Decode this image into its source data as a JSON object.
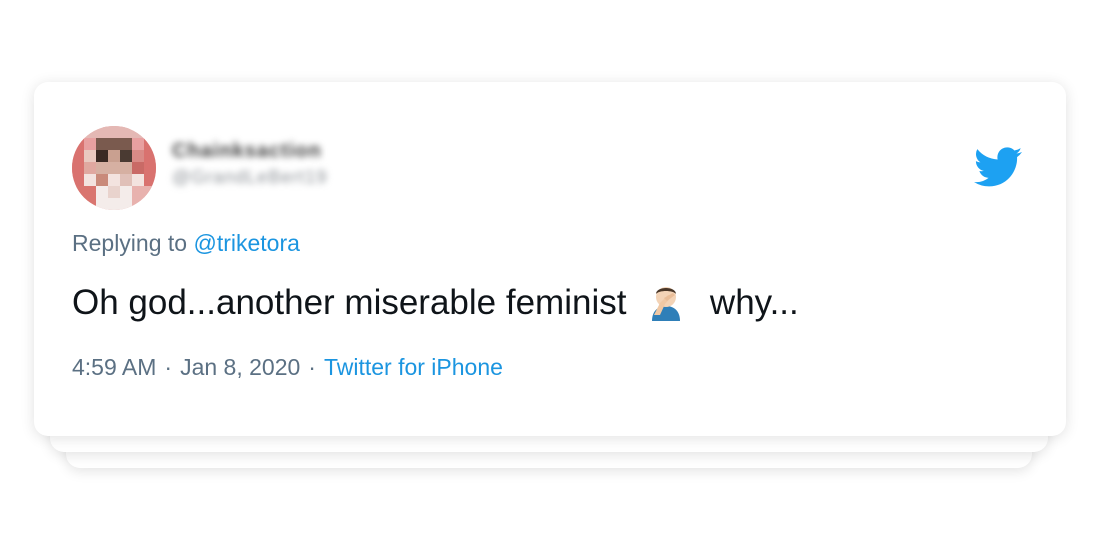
{
  "tweet": {
    "author": {
      "display_name": "Chainksaction",
      "handle": "@GrandLeBert19"
    },
    "replying_prefix": "Replying to ",
    "replying_to": "@triketora",
    "text_before_emoji": "Oh god...another miserable feminist",
    "emoji_icon": "man-facepalming-emoji",
    "text_after_emoji": "why...",
    "time": "4:59 AM",
    "separator": "·",
    "date": "Jan 8, 2020",
    "source": "Twitter for iPhone"
  },
  "colors": {
    "twitter_blue": "#1da1f2",
    "link_blue": "#1b95e0",
    "secondary_text": "#5b7083",
    "primary_text": "#0f1419"
  },
  "icons": {
    "brand": "twitter-bird-icon",
    "avatar": "blurred-avatar"
  }
}
